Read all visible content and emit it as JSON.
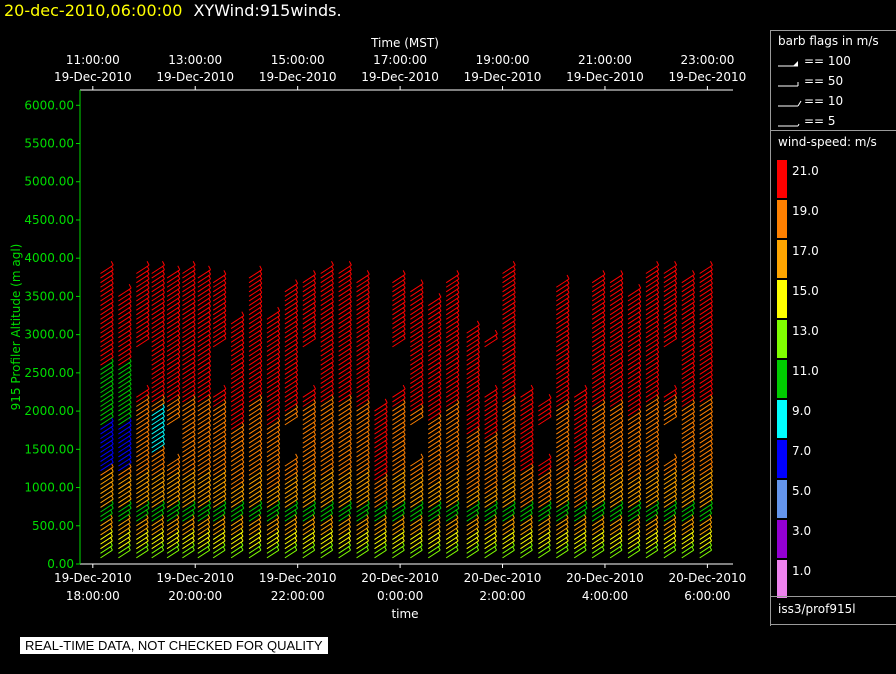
{
  "header": {
    "timestamp": "20-dec-2010,06:00:00",
    "product": "XYWind:915winds."
  },
  "qc_notice": "REAL-TIME DATA, NOT CHECKED FOR QUALITY",
  "barb_key": {
    "title": "barb flags in m/s",
    "entries": [
      {
        "label": "== 100",
        "kind": "flag-full"
      },
      {
        "label": "== 50",
        "kind": "flag"
      },
      {
        "label": "== 10",
        "kind": "full-barb"
      },
      {
        "label": "== 5",
        "kind": "half-barb"
      }
    ]
  },
  "colorbar": {
    "title": "wind-speed: m/s",
    "bins": [
      {
        "label": "21.0",
        "color": "#ff0000"
      },
      {
        "label": "19.0",
        "color": "#ff8000"
      },
      {
        "label": "17.0",
        "color": "#ffa500"
      },
      {
        "label": "15.0",
        "color": "#ffff00"
      },
      {
        "label": "13.0",
        "color": "#80ff00"
      },
      {
        "label": "11.0",
        "color": "#00cc00"
      },
      {
        "label": "9.0",
        "color": "#00ffff"
      },
      {
        "label": "7.0",
        "color": "#0000ff"
      },
      {
        "label": "5.0",
        "color": "#6495ed"
      },
      {
        "label": "3.0",
        "color": "#9400d3"
      },
      {
        "label": "1.0",
        "color": "#ee82ee"
      }
    ]
  },
  "station": "iss3/prof915l",
  "chart_data": {
    "type": "scatter",
    "title": "",
    "xlabel": "time",
    "x2label": "Time (MST)",
    "ylabel": "915 Profiler Altitude (m agl)",
    "ylim": [
      0,
      6200
    ],
    "yticks": [
      "0.00",
      "500.00",
      "1000.00",
      "1500.00",
      "2000.00",
      "2500.00",
      "3000.00",
      "3500.00",
      "4000.00",
      "4500.00",
      "5000.00",
      "5500.00",
      "6000.00"
    ],
    "xlim_hours": [
      17.75,
      30.5
    ],
    "xticks_bottom": [
      {
        "h": 18,
        "line1": "19-Dec-2010",
        "line2": "18:00:00"
      },
      {
        "h": 20,
        "line1": "19-Dec-2010",
        "line2": "20:00:00"
      },
      {
        "h": 22,
        "line1": "19-Dec-2010",
        "line2": "22:00:00"
      },
      {
        "h": 24,
        "line1": "20-Dec-2010",
        "line2": "0:00:00"
      },
      {
        "h": 26,
        "line1": "20-Dec-2010",
        "line2": "2:00:00"
      },
      {
        "h": 28,
        "line1": "20-Dec-2010",
        "line2": "4:00:00"
      },
      {
        "h": 30,
        "line1": "20-Dec-2010",
        "line2": "6:00:00"
      }
    ],
    "xticks_top": [
      {
        "h": 18,
        "line1": "11:00:00",
        "line2": "19-Dec-2010"
      },
      {
        "h": 20,
        "line1": "13:00:00",
        "line2": "19-Dec-2010"
      },
      {
        "h": 22,
        "line1": "15:00:00",
        "line2": "19-Dec-2010"
      },
      {
        "h": 24,
        "line1": "17:00:00",
        "line2": "19-Dec-2010"
      },
      {
        "h": 26,
        "line1": "19:00:00",
        "line2": "19-Dec-2010"
      },
      {
        "h": 28,
        "line1": "21:00:00",
        "line2": "19-Dec-2010"
      },
      {
        "h": 30,
        "line1": "23:00:00",
        "line2": "19-Dec-2010"
      }
    ],
    "profile_hours": [
      18.15,
      18.5,
      18.85,
      19.15,
      19.45,
      19.75,
      20.05,
      20.35,
      20.7,
      21.05,
      21.4,
      21.75,
      22.1,
      22.45,
      22.8,
      23.15,
      23.5,
      23.85,
      24.2,
      24.55,
      24.9,
      25.3,
      25.65,
      26.0,
      26.35,
      26.7,
      27.05,
      27.4,
      27.75,
      28.1,
      28.45,
      28.8,
      29.15,
      29.5,
      29.85
    ],
    "profile_tops_m": [
      3850,
      3550,
      3850,
      3850,
      3750,
      3800,
      3750,
      3700,
      3150,
      3750,
      3250,
      3600,
      3700,
      3850,
      3800,
      3700,
      2000,
      3700,
      3600,
      3400,
      3700,
      3050,
      2950,
      3800,
      2200,
      2100,
      3650,
      2300,
      3700,
      3700,
      3500,
      3850,
      3800,
      3700,
      3850
    ],
    "speed_by_altitude": {
      "low": 12,
      "mid": 18,
      "high": 21
    }
  }
}
